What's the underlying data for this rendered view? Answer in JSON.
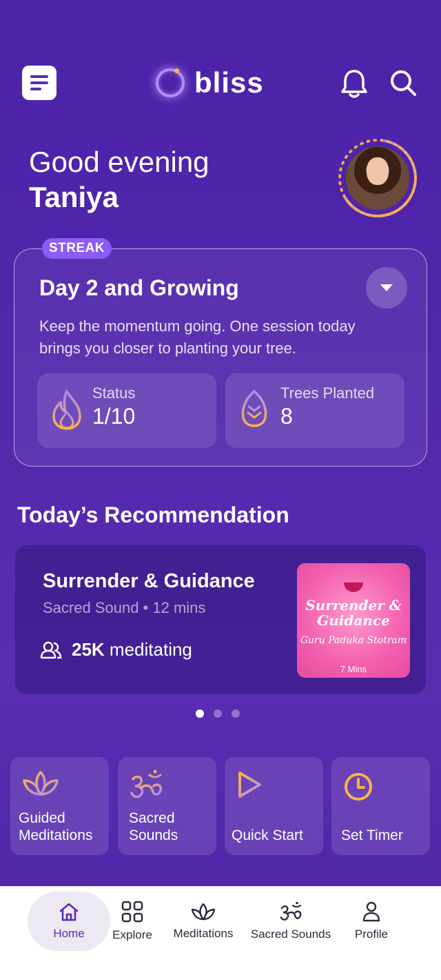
{
  "header": {
    "logo_text": "bliss",
    "icons": [
      "menu-icon",
      "bell-icon",
      "search-icon"
    ]
  },
  "greeting": {
    "salutation": "Good evening",
    "name": "Taniya"
  },
  "streak": {
    "badge": "STREAK",
    "title": "Day 2 and Growing",
    "description": "Keep the momentum going. One session today brings you closer to planting your tree.",
    "stats": [
      {
        "label": "Status",
        "value": "1/10",
        "icon": "flame-icon"
      },
      {
        "label": "Trees Planted",
        "value": "8",
        "icon": "leaf-icon"
      }
    ]
  },
  "recommendation": {
    "section_title": "Today’s Recommendation",
    "title": "Surrender & Guidance",
    "meta": "Sacred Sound • 12 mins",
    "count": "25K",
    "count_suffix": " meditating",
    "artwork": {
      "title": "Surrender & Guidance",
      "subtitle": "Guru Paduka Stotram",
      "duration": "7 Mins"
    },
    "carousel": {
      "pages": 3,
      "active": 1
    }
  },
  "quick_tiles": [
    {
      "label": "Guided Meditations",
      "icon": "lotus-icon"
    },
    {
      "label": "Sacred Sounds",
      "icon": "om-icon"
    },
    {
      "label": "Quick Start",
      "icon": "play-icon"
    },
    {
      "label": "Set Timer",
      "icon": "clock-icon"
    }
  ],
  "bottom_nav": [
    {
      "label": "Home",
      "icon": "home-icon",
      "active": true
    },
    {
      "label": "Explore",
      "icon": "grid-icon"
    },
    {
      "label": "Meditations",
      "icon": "lotus-icon"
    },
    {
      "label": "Sacred Sounds",
      "icon": "om-icon"
    },
    {
      "label": "Profile",
      "icon": "user-icon"
    }
  ],
  "colors": {
    "background": "#4b22a8",
    "accent": "#8b5cf6",
    "icon_gradient_start": "#ffb347",
    "icon_gradient_end": "#a78bfa"
  }
}
